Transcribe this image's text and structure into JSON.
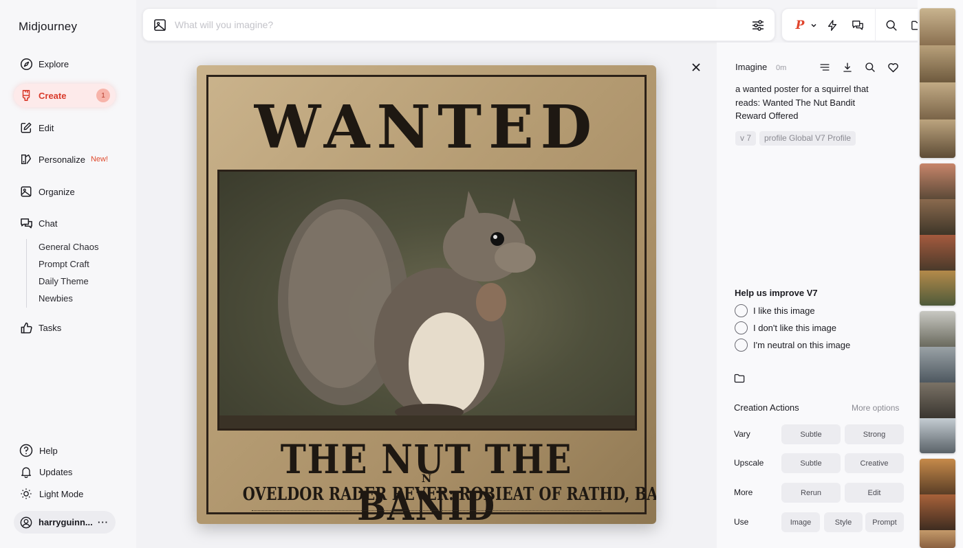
{
  "app": {
    "name": "Midjourney"
  },
  "sidebar": {
    "items": [
      {
        "label": "Explore",
        "icon": "compass-icon"
      },
      {
        "label": "Create",
        "icon": "brush-icon",
        "badge": "1"
      },
      {
        "label": "Edit",
        "icon": "edit-icon"
      },
      {
        "label": "Personalize",
        "icon": "personalize-icon",
        "tag": "New!"
      },
      {
        "label": "Organize",
        "icon": "image-icon"
      },
      {
        "label": "Chat",
        "icon": "chat-icon"
      },
      {
        "label": "Tasks",
        "icon": "thumbs-up-icon"
      }
    ],
    "chat_rooms": [
      "General Chaos",
      "Prompt Craft",
      "Daily Theme",
      "Newbies"
    ],
    "bottom": [
      {
        "label": "Help",
        "icon": "help-icon"
      },
      {
        "label": "Updates",
        "icon": "bell-icon"
      },
      {
        "label": "Light Mode",
        "icon": "sun-icon"
      }
    ],
    "user": {
      "name": "harryguinn...",
      "menu": "···"
    }
  },
  "search": {
    "placeholder": "What will you imagine?"
  },
  "toolbar": {
    "personalize_label": "P"
  },
  "poster": {
    "title": "WANTED",
    "subtitle": "THE NUT THE BANID",
    "mark": "N",
    "line": "OVELDOR RADER REVER: ROBIEAT OF RATHD, BANINIC."
  },
  "detail": {
    "mode": "Imagine",
    "time": "0m",
    "prompt": "a wanted poster for a squirrel that reads: Wanted The Nut Bandit Reward Offered",
    "chips": [
      "v 7",
      "profile Global V7 Profile"
    ],
    "feedback": {
      "title": "Help us improve V7",
      "options": [
        "I like this image",
        "I don't like this image",
        "I'm neutral on this image"
      ]
    },
    "actions": {
      "title": "Creation Actions",
      "more": "More options",
      "rows": [
        {
          "label": "Vary",
          "buttons": [
            "Subtle",
            "Strong"
          ]
        },
        {
          "label": "Upscale",
          "buttons": [
            "Subtle",
            "Creative"
          ]
        },
        {
          "label": "More",
          "buttons": [
            "Rerun",
            "Edit"
          ]
        },
        {
          "label": "Use",
          "buttons": [
            "Image",
            "Style",
            "Prompt"
          ]
        }
      ]
    }
  },
  "colors": {
    "accent": "#d93a2b",
    "badge_bg": "#f7b4aa",
    "poster_paper": "#b69d74"
  }
}
